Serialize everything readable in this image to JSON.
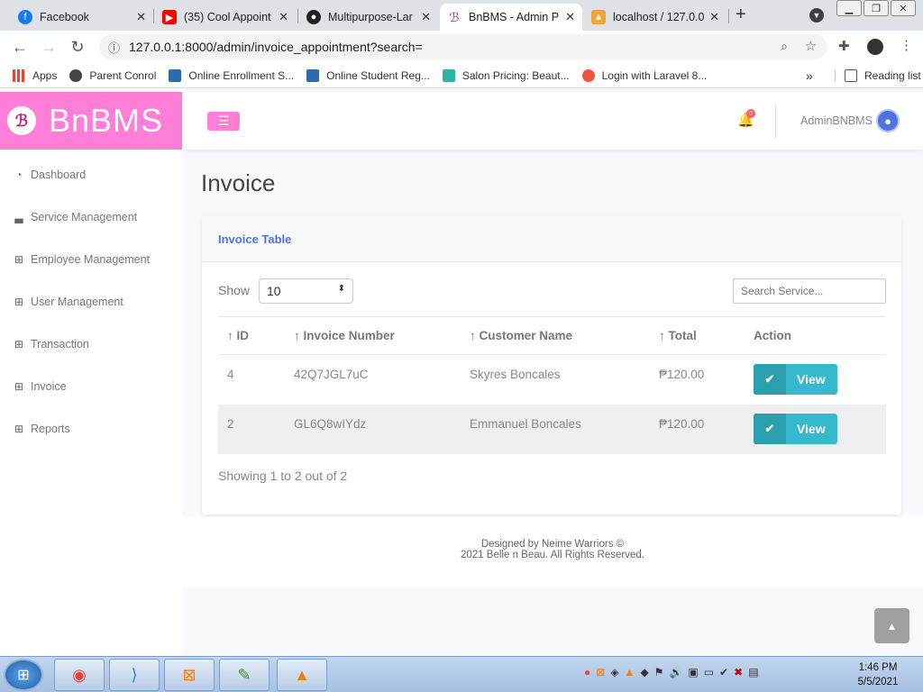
{
  "browser": {
    "tabs": [
      {
        "label": "Facebook",
        "icon": "facebook-icon",
        "color": "#1877f2",
        "glyph": "f"
      },
      {
        "label": "(35) Cool Appoint",
        "icon": "youtube-icon",
        "color": "#ff0000",
        "glyph": "▶"
      },
      {
        "label": "Multipurpose-Lar",
        "icon": "github-icon",
        "color": "#222222",
        "glyph": "●"
      },
      {
        "label": "BnBMS - Admin P",
        "icon": "bnbms-icon",
        "color": "#c0267a",
        "glyph": "ℬ"
      },
      {
        "label": "localhost / 127.0.0",
        "icon": "phpmyadmin-icon",
        "color": "#f2a33a",
        "glyph": "▲"
      }
    ],
    "url": "127.0.0.1:8000/admin/invoice_appointment?search=",
    "bookmarks": [
      {
        "label": "Apps",
        "icon": "apps-icon",
        "color": "#e94235"
      },
      {
        "label": "Parent Conrol",
        "icon": "globe-icon",
        "color": "#444444"
      },
      {
        "label": "Online Enrollment S...",
        "icon": "site-icon",
        "color": "#2b6cb0"
      },
      {
        "label": "Online Student Reg...",
        "icon": "site-icon",
        "color": "#2b6cb0"
      },
      {
        "label": "Salon Pricing: Beaut...",
        "icon": "salon-icon",
        "color": "#2ab3a6"
      },
      {
        "label": "Login with Laravel 8...",
        "icon": "laravel-icon",
        "color": "#f05340"
      }
    ],
    "reading_list": "Reading list",
    "overflow": "»"
  },
  "sidebar": {
    "brand": "BnBMS",
    "items": [
      {
        "label": "Dashboard",
        "icon": "dashboard-icon",
        "glyph": "◔"
      },
      {
        "label": "Service Management",
        "icon": "chart-icon",
        "glyph": "▁▃"
      },
      {
        "label": "Employee Management",
        "icon": "table-icon",
        "glyph": "⊞"
      },
      {
        "label": "User Management",
        "icon": "table-icon",
        "glyph": "⊞"
      },
      {
        "label": "Transaction",
        "icon": "table-icon",
        "glyph": "⊞"
      },
      {
        "label": "Invoice",
        "icon": "table-icon",
        "glyph": "⊞"
      },
      {
        "label": "Reports",
        "icon": "table-icon",
        "glyph": "⊞"
      }
    ]
  },
  "topbar": {
    "username": "AdminBNBMS",
    "notification_count": "0"
  },
  "page": {
    "title": "Invoice",
    "card_title": "Invoice Table",
    "show_label": "Show",
    "page_size": "10",
    "search_placeholder": "Search Service...",
    "columns": [
      "ID",
      "Invoice Number",
      "Customer Name",
      "Total",
      "Action"
    ],
    "rows": [
      {
        "id": "4",
        "invoice": "42Q7JGL7uC",
        "customer": "Skyres Boncales",
        "total": "₱120.00",
        "action": "View"
      },
      {
        "id": "2",
        "invoice": "GL6Q8wIYdz",
        "customer": "Emmanuel Boncales",
        "total": "₱120.00",
        "action": "View"
      }
    ],
    "showing": "Showing 1 to 2 out of 2"
  },
  "footer": {
    "line1": "Designed by Neime Warriors ©",
    "line2": "2021 Belle n Beau. All Rights Reserved."
  },
  "taskbar": {
    "time": "1:46 PM",
    "date": "5/5/2021"
  },
  "colors": {
    "brand_pink": "#ff7fd8",
    "primary": "#4e73df",
    "info": "#36b9cc"
  }
}
